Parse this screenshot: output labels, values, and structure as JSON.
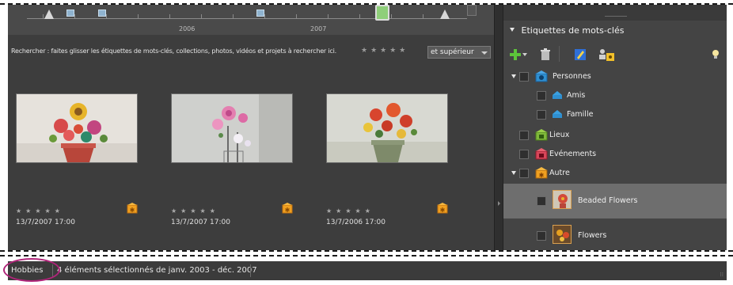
{
  "timeline": {
    "years": [
      "2006",
      "2007"
    ]
  },
  "search": {
    "hint": "Rechercher : faites glisser les étiquettes de mots-clés, collections, photos, vidéos et projets à rechercher ici.",
    "stars": "★★★★★",
    "rating_filter": "et supérieur"
  },
  "photos": [
    {
      "stars": "★★★★★",
      "date": "13/7/2007 17:00",
      "tag_icon": "tag-other-icon"
    },
    {
      "stars": "★★★★★",
      "date": "13/7/2007 17:00",
      "tag_icon": "tag-other-icon"
    },
    {
      "stars": "★★★★★",
      "date": "13/7/2006 17:00",
      "tag_icon": "tag-other-icon"
    }
  ],
  "panel": {
    "title": "Etiquettes de mots-clés"
  },
  "tags": [
    {
      "label": "Personnes",
      "level": 0,
      "expanded": true,
      "icon": "people-tag-icon"
    },
    {
      "label": "Amis",
      "level": 1,
      "icon": "sub-tag-icon"
    },
    {
      "label": "Famille",
      "level": 1,
      "icon": "sub-tag-icon"
    },
    {
      "label": "Lieux",
      "level": 0,
      "icon": "places-tag-icon"
    },
    {
      "label": "Evénements",
      "level": 0,
      "icon": "events-tag-icon"
    },
    {
      "label": "Autre",
      "level": 0,
      "expanded": true,
      "icon": "other-tag-icon"
    },
    {
      "label": "Beaded Flowers",
      "level": 1,
      "selected": true,
      "icon": "photo-tag-thumbnail"
    },
    {
      "label": "Flowers",
      "level": 1,
      "icon": "photo-tag-thumbnail"
    }
  ],
  "status": {
    "album": "Hobbies",
    "text": "4 éléments sélectionnés de janv. 2003 - déc. 2007"
  },
  "colors": {
    "accent_annotation": "#b0257a",
    "panel_bg": "#444444",
    "grid_bg": "#3d3d3d",
    "people_tag": "#2f8fd0",
    "places_tag": "#7fb83a",
    "events_tag": "#d8465a",
    "other_tag": "#f0a020"
  }
}
